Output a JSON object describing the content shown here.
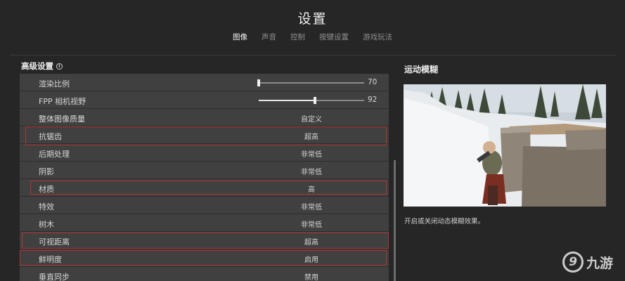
{
  "header": {
    "title": "设置",
    "tabs": [
      {
        "label": "图像",
        "active": true
      },
      {
        "label": "声音",
        "active": false
      },
      {
        "label": "控制",
        "active": false
      },
      {
        "label": "按键设置",
        "active": false
      },
      {
        "label": "游戏玩法",
        "active": false
      }
    ]
  },
  "advanced": {
    "title": "高级设置",
    "info_icon": "i",
    "rows": [
      {
        "label": "渲染比例",
        "type": "slider",
        "value": "70",
        "fraction": 0.0
      },
      {
        "label": "FPP 相机视野",
        "type": "slider",
        "value": "92",
        "fraction": 0.533
      },
      {
        "label": "整体图像质量",
        "value": "自定义",
        "highlighted": false
      },
      {
        "label": "抗锯齿",
        "value": "超高",
        "highlighted": true
      },
      {
        "label": "后期处理",
        "value": "非常低",
        "highlighted": false
      },
      {
        "label": "阴影",
        "value": "非常低",
        "highlighted": false
      },
      {
        "label": "材质",
        "value": "高",
        "highlighted": true
      },
      {
        "label": "特效",
        "value": "非常低",
        "highlighted": false
      },
      {
        "label": "树木",
        "value": "非常低",
        "highlighted": false
      },
      {
        "label": "可视距离",
        "value": "超高",
        "highlighted": true
      },
      {
        "label": "鲜明度",
        "value": "启用",
        "highlighted": true
      },
      {
        "label": "垂直同步",
        "value": "禁用",
        "highlighted": false
      }
    ]
  },
  "preview": {
    "title": "运动模糊",
    "description": "开启或关闭动态模糊效果。"
  },
  "watermark": {
    "logo": "9",
    "text": "九游"
  },
  "colors": {
    "background": "#262626",
    "row": "#404040",
    "highlight": "#b33333"
  }
}
